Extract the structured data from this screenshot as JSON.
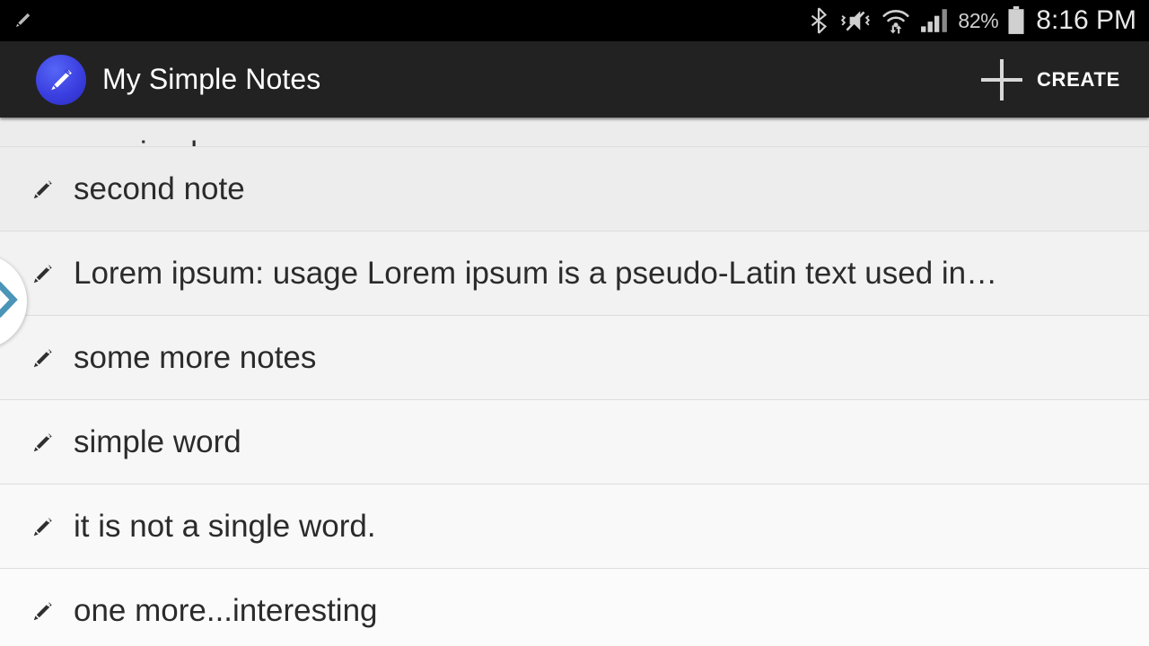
{
  "status_bar": {
    "notification_icon": "pencil-notification-icon",
    "icons": [
      "bluetooth-icon",
      "vibrate-mute-icon",
      "wifi-icon",
      "cellular-signal-icon"
    ],
    "battery_percent": "82%",
    "battery_icon": "battery-icon",
    "clock": "8:16 PM"
  },
  "action_bar": {
    "app_icon": "notes-pencil-app-icon",
    "title": "My Simple Notes",
    "create": {
      "icon": "plus-icon",
      "label": "CREATE"
    }
  },
  "drawer_handle": {
    "icon": "chevron-right-icon",
    "color": "#4a95b8"
  },
  "colors": {
    "status_bar_bg": "#000000",
    "action_bar_bg": "#222222",
    "list_bg": "#fafafa",
    "divider": "#dddddd",
    "text": "#2b2b2b",
    "accent_chevron": "#4a95b8",
    "app_icon_blue": "#3b3fe0"
  },
  "note_list": {
    "items": [
      {
        "text": "my simple app",
        "icon": "pencil-icon",
        "clipped": true
      },
      {
        "text": "second note",
        "icon": "pencil-icon",
        "clipped": false
      },
      {
        "text": "Lorem ipsum: usage Lorem ipsum is a pseudo-Latin text used in…",
        "icon": "pencil-icon",
        "clipped": false
      },
      {
        "text": "some more notes",
        "icon": "pencil-icon",
        "clipped": false
      },
      {
        "text": "simple word",
        "icon": "pencil-icon",
        "clipped": false
      },
      {
        "text": "it is not a single word.",
        "icon": "pencil-icon",
        "clipped": false
      },
      {
        "text": "one more...interesting",
        "icon": "pencil-icon",
        "clipped": false
      }
    ]
  }
}
